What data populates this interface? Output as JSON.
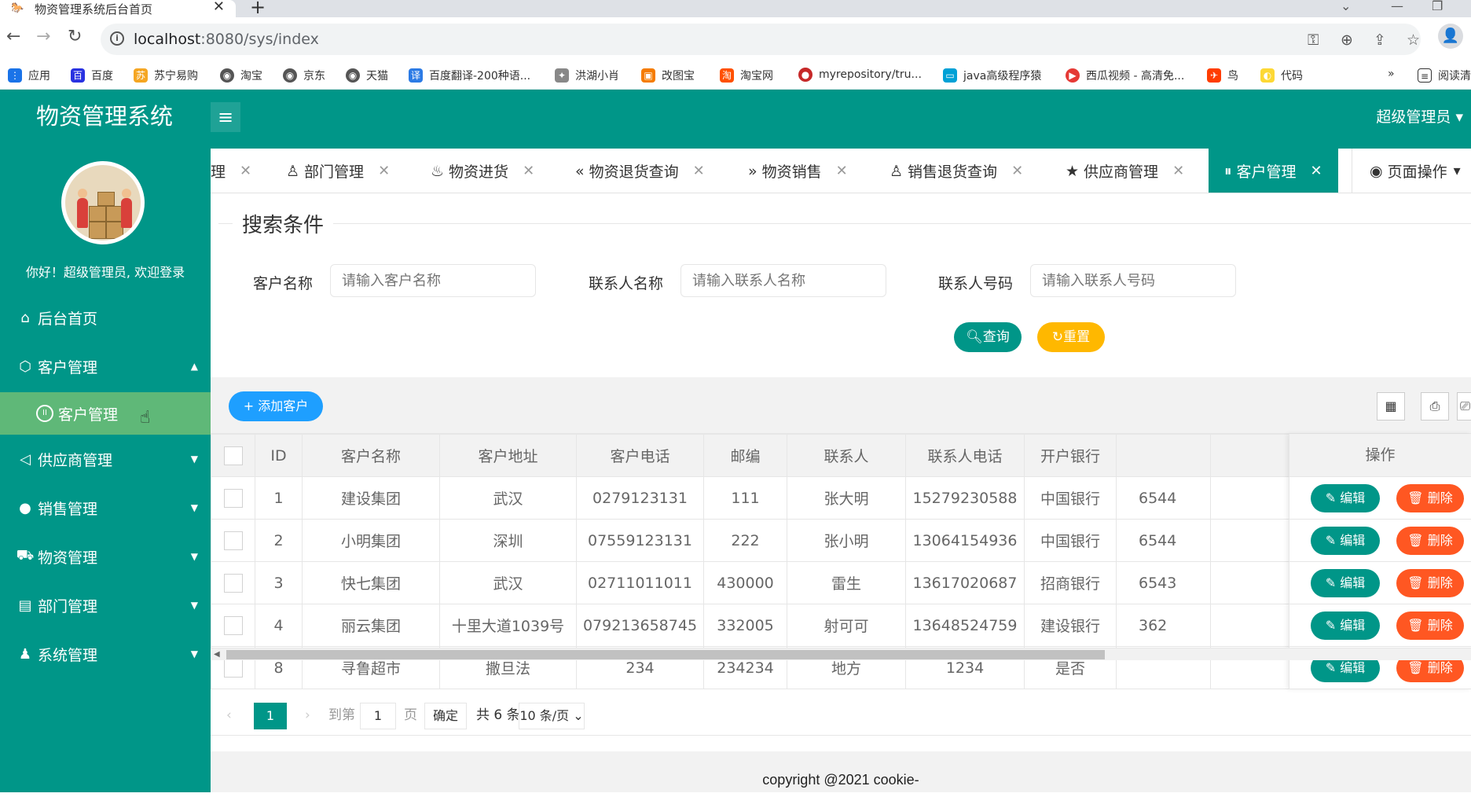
{
  "browser": {
    "tab_title": "物资管理系统后台首页",
    "url_host": "localhost",
    "url_rest": ":8080/sys/index",
    "bookmarks": [
      "应用",
      "百度",
      "苏宁易购",
      "淘宝",
      "京东",
      "天猫",
      "百度翻译-200种语...",
      "洪湖小肖",
      "改图宝",
      "淘宝网",
      "myrepository/tru...",
      "java高级程序猿",
      "西瓜视频 - 高清免...",
      "鸟",
      "代码",
      "阅读清单"
    ],
    "more": "»"
  },
  "header": {
    "logo": "物资管理系统",
    "user": "超级管理员"
  },
  "sidebar": {
    "welcome": "你好！超级管理员, 欢迎登录",
    "items": [
      {
        "label": "后台首页",
        "icon": "home-icon"
      },
      {
        "label": "客户管理",
        "icon": "box-icon"
      },
      {
        "label": "供应商管理",
        "icon": "speaker-icon"
      },
      {
        "label": "销售管理",
        "icon": "chat-icon"
      },
      {
        "label": "物资管理",
        "icon": "cart-icon"
      },
      {
        "label": "部门管理",
        "icon": "list-icon"
      },
      {
        "label": "系统管理",
        "icon": "user-icon"
      }
    ],
    "sub_item": "客户管理"
  },
  "tabs": [
    {
      "label": "理"
    },
    {
      "label": "部门管理"
    },
    {
      "label": "物资进货"
    },
    {
      "label": "物资退货查询"
    },
    {
      "label": "物资销售"
    },
    {
      "label": "销售退货查询"
    },
    {
      "label": "供应商管理"
    },
    {
      "label": "客户管理"
    },
    {
      "label": "页面操作"
    }
  ],
  "search": {
    "legend": "搜索条件",
    "customer_label": "客户名称",
    "customer_placeholder": "请输入客户名称",
    "contact_label": "联系人名称",
    "contact_placeholder": "请输入联系人名称",
    "phone_label": "联系人号码",
    "phone_placeholder": "请输入联系人号码",
    "query": "查询",
    "reset": "重置"
  },
  "table": {
    "add_button": "添加客户",
    "columns": [
      "ID",
      "客户名称",
      "客户地址",
      "客户电话",
      "邮编",
      "联系人",
      "联系人电话",
      "开户银行",
      "",
      "操作"
    ],
    "rows": [
      [
        "1",
        "建设集团",
        "武汉",
        "0279123131",
        "111",
        "张大明",
        "15279230588",
        "中国银行",
        "6544"
      ],
      [
        "2",
        "小明集团",
        "深圳",
        "07559123131",
        "222",
        "张小明",
        "13064154936",
        "中国银行",
        "6544"
      ],
      [
        "3",
        "快七集团",
        "武汉",
        "02711011011",
        "430000",
        "雷生",
        "13617020687",
        "招商银行",
        "6543"
      ],
      [
        "4",
        "丽云集团",
        "十里大道1039号",
        "079213658745",
        "332005",
        "射可可",
        "13648524759",
        "建设银行",
        "362"
      ],
      [
        "8",
        "寻鲁超市",
        "撒旦法",
        "234",
        "234234",
        "地方",
        "1234",
        "是否",
        ""
      ]
    ],
    "edit": "编辑",
    "delete": "删除"
  },
  "pager": {
    "current": "1",
    "goto": "到第",
    "page_input": "1",
    "page": "页",
    "confirm": "确定",
    "total": "共 6 条",
    "per_page": "10 条/页"
  },
  "footer": "copyright @2021 cookie-"
}
